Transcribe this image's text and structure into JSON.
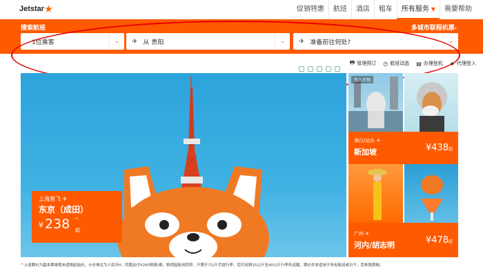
{
  "brand": {
    "logo_text": "Jetstar",
    "accent_color": "#ff5a00"
  },
  "nav": {
    "items": [
      "促销特惠",
      "航班",
      "酒店",
      "租车",
      "所有服务",
      "需要帮助"
    ],
    "active_index": 4
  },
  "search": {
    "title": "搜索航班",
    "multi_city": "多城市联程机票",
    "passengers": "1位乘客",
    "origin": "从 贵阳",
    "destination": "准备前往何处?"
  },
  "utility": {
    "items": [
      "管理预订",
      "航班动态",
      "办理登机",
      "代理登入"
    ]
  },
  "hero": {
    "route": "上海直飞",
    "destination": "东京（成田）",
    "currency": "¥",
    "price": "238",
    "star": "^",
    "unit": "起"
  },
  "tiles": [
    {
      "badge": "加入计划",
      "route": "海口/汕头",
      "destination": "新加坡",
      "price": "¥438",
      "unit": "起"
    },
    {
      "route": "广州",
      "destination": "河内/胡志明",
      "price": "¥478",
      "unit": "起"
    }
  ],
  "footnote": "^上述票价为基本票单程未适税起始价，计价单位为人民币¥，同篇支付¥260税费/费，税项因航线而异，只限于7公斤手提行李，您可另购15公斤至40公斤行李托运额，票价并非适用于所有航班或日子，受条款限制。"
}
